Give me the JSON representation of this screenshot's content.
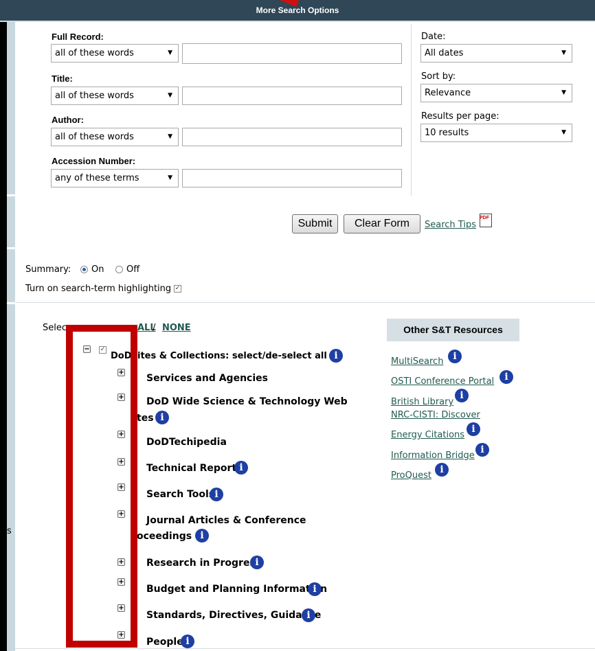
{
  "header": {
    "title": "More Search Options"
  },
  "search_fields": [
    {
      "label": "Full Record:",
      "operator": "all of these words",
      "value": ""
    },
    {
      "label": "Title:",
      "operator": "all of these words",
      "value": ""
    },
    {
      "label": "Author:",
      "operator": "all of these words",
      "value": ""
    },
    {
      "label": "Accession Number:",
      "operator": "any of these terms",
      "value": ""
    }
  ],
  "filters": {
    "date": {
      "label": "Date:",
      "value": "All dates"
    },
    "sort": {
      "label": "Sort by:",
      "value": "Relevance"
    },
    "per_page": {
      "label": "Results per page:",
      "value": "10 results"
    }
  },
  "actions": {
    "submit": "Submit",
    "clear": "Clear Form",
    "tips": "Search Tips",
    "pdf": "PDF"
  },
  "summary": {
    "label": "Summary:",
    "on": "On",
    "off": "Off",
    "selected": "On"
  },
  "highlight": {
    "label": "Turn on search-term highlighting",
    "checked": true
  },
  "select": {
    "prefix": "Selec",
    "all": "ALL",
    "separator": "/",
    "none": "NONE"
  },
  "tree": {
    "root_prefix": "DoD",
    "root_suffix": "ites & Collections:  select/de-select all",
    "items": [
      {
        "line1": "Services and Agencies",
        "line2": ""
      },
      {
        "line1": "DoD Wide Science & Technology Web",
        "line2": "tes"
      },
      {
        "line1": "DoDTechipedia",
        "line2": ""
      },
      {
        "line1": "Technical Reports",
        "line2": ""
      },
      {
        "line1": "Search Tools",
        "line2": ""
      },
      {
        "line1": "Journal Articles & Conference",
        "line2": "oceedings"
      },
      {
        "line1": "Research in Progress",
        "line2": ""
      },
      {
        "line1": "Budget and Planning Information",
        "line2": ""
      },
      {
        "line1": "Standards, Directives, Guidance",
        "line2": ""
      },
      {
        "line1": "People",
        "line2": ""
      }
    ]
  },
  "left_fragment": "s",
  "resources": {
    "heading": "Other S&T Resources",
    "links": [
      "MultiSearch",
      "OSTI Conference Portal",
      "British Library",
      "NRC-CISTI: Discover",
      "Energy Citations",
      "Information Bridge",
      "ProQuest"
    ]
  },
  "colors": {
    "header": "#2f4756",
    "annotation": "#c00000",
    "info": "#1e3fa3",
    "link": "#1f5a4e"
  }
}
